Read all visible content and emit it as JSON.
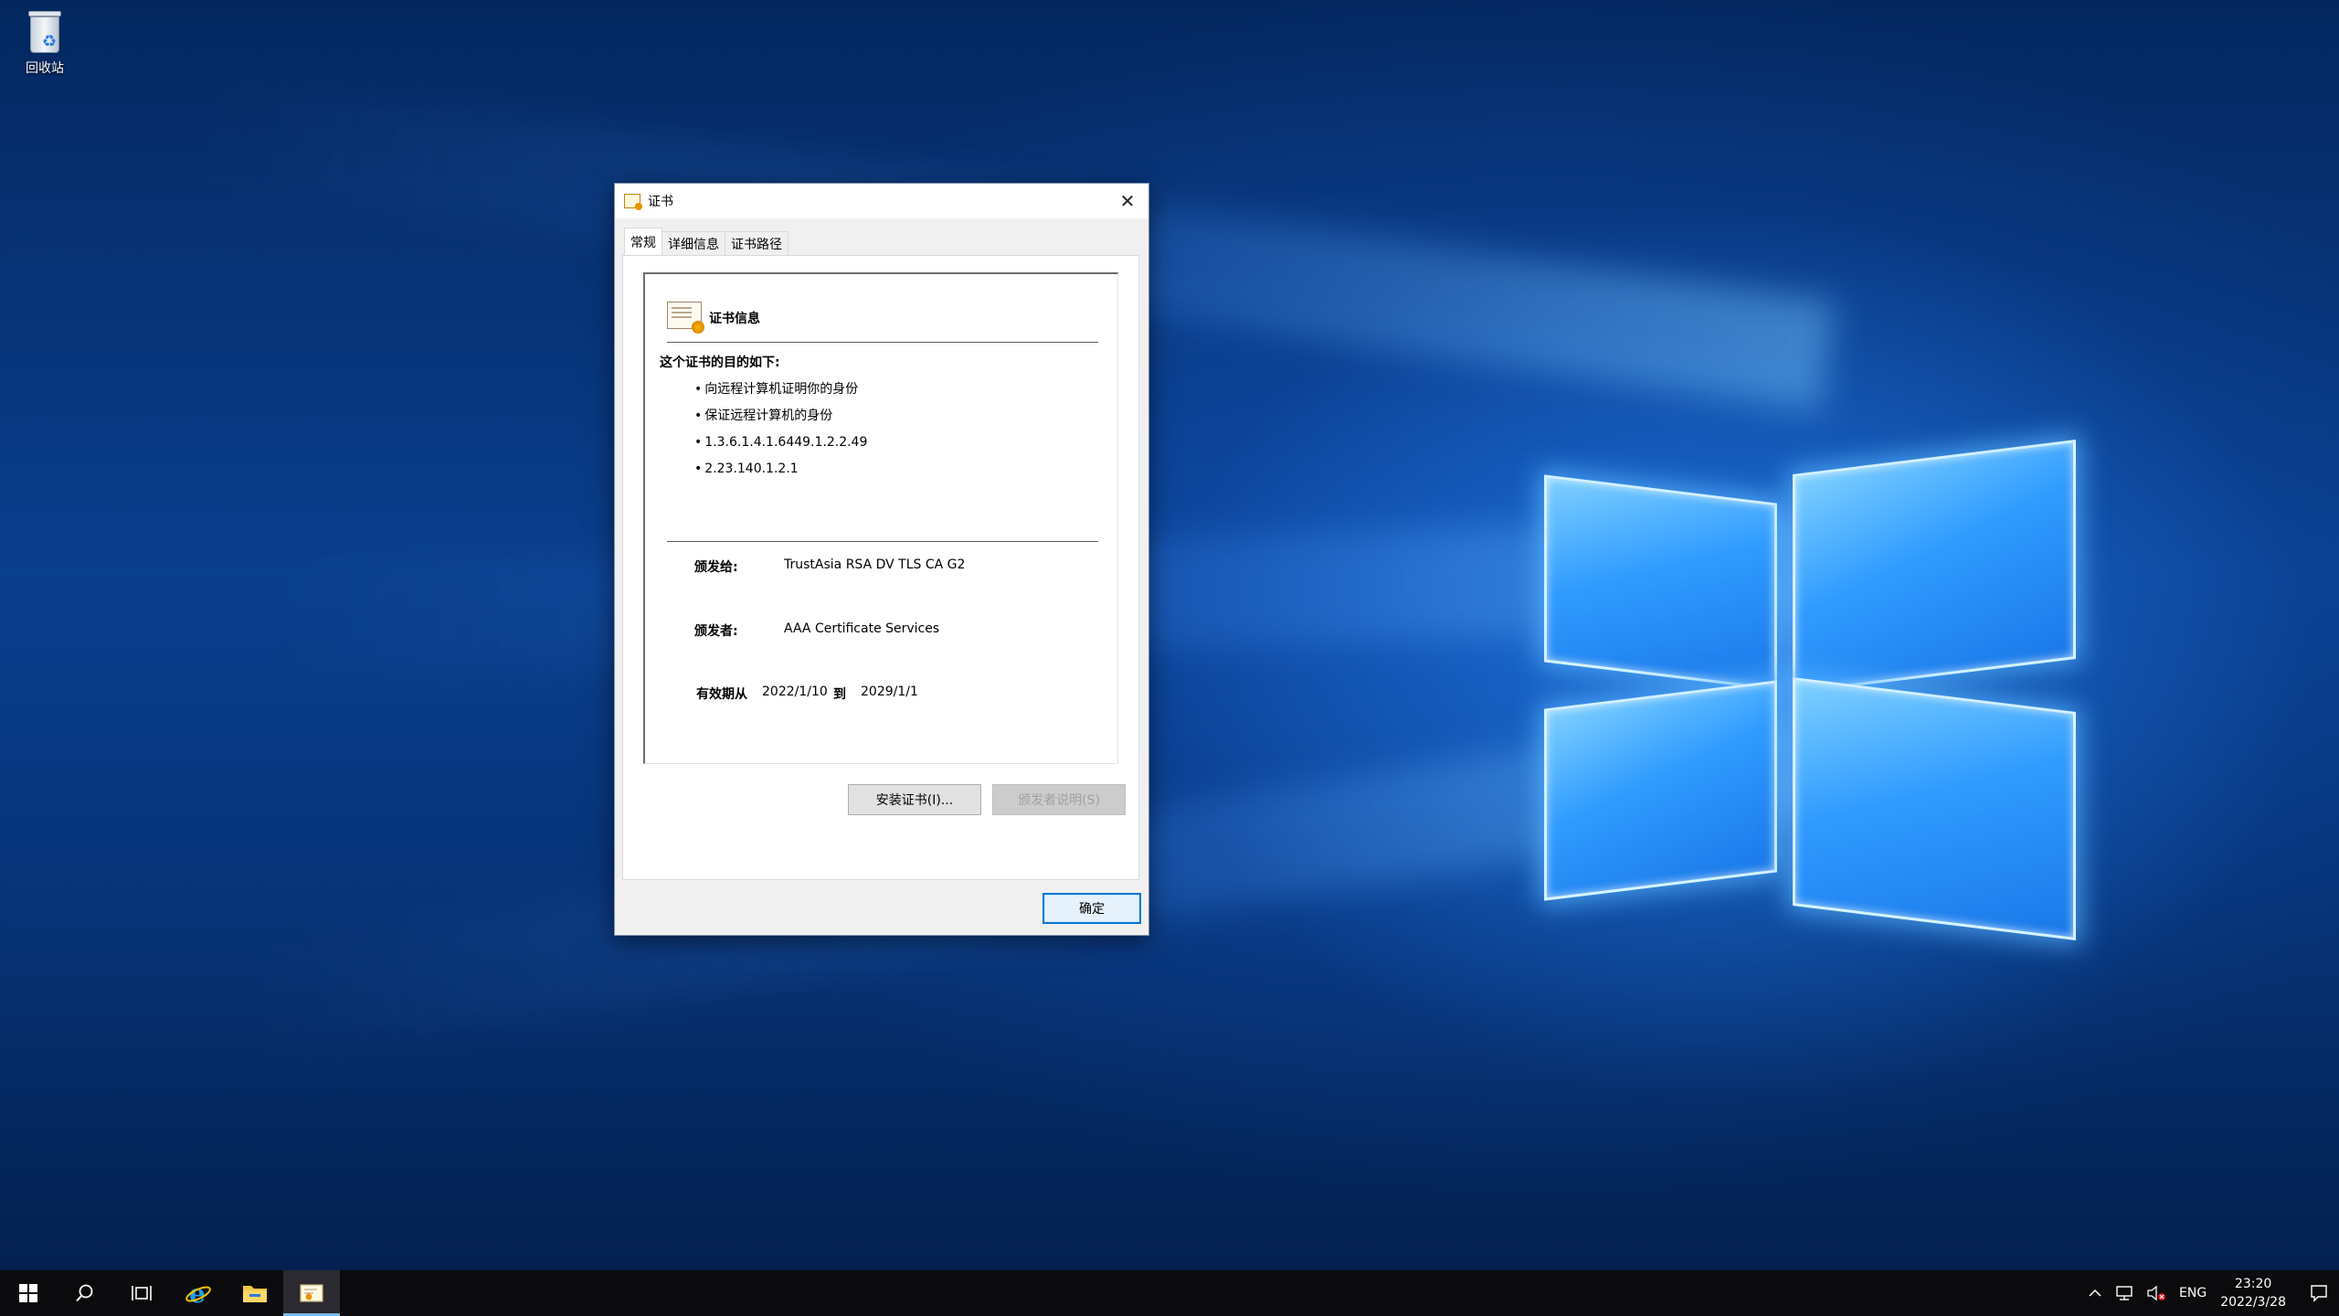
{
  "desktop": {
    "icons": [
      {
        "label": "回收站",
        "icon": "recycle-bin-icon"
      }
    ]
  },
  "dialog": {
    "title": "证书",
    "close_glyph": "✕",
    "tabs": [
      {
        "label": "常规",
        "active": true
      },
      {
        "label": "详细信息",
        "active": false
      },
      {
        "label": "证书路径",
        "active": false
      }
    ],
    "info_header": "证书信息",
    "purpose_title": "这个证书的目的如下:",
    "purposes": [
      "向远程计算机证明你的身份",
      "保证远程计算机的身份",
      "1.3.6.1.4.1.6449.1.2.2.49",
      "2.23.140.1.2.1"
    ],
    "issued_to_label": "颁发给:",
    "issued_to_value": "TrustAsia RSA DV TLS CA G2",
    "issued_by_label": "颁发者:",
    "issued_by_value": "AAA Certificate Services",
    "validity_label": "有效期从",
    "valid_from": "2022/1/10",
    "validity_to_word": "到",
    "valid_to": "2029/1/1",
    "install_button": "安装证书(I)...",
    "issuer_statement_button": "颁发者说明(S)",
    "issuer_statement_enabled": false,
    "ok_button": "确定"
  },
  "taskbar": {
    "items": [
      {
        "name": "start",
        "icon": "windows-logo-icon"
      },
      {
        "name": "search",
        "icon": "search-icon"
      },
      {
        "name": "task-view",
        "icon": "task-view-icon"
      },
      {
        "name": "internet-explorer",
        "icon": "ie-icon"
      },
      {
        "name": "file-explorer",
        "icon": "folder-icon"
      },
      {
        "name": "certificate",
        "icon": "certificate-icon",
        "active": true
      }
    ],
    "tray": {
      "language": "ENG",
      "time": "23:20",
      "date": "2022/3/28"
    }
  },
  "colors": {
    "accent": "#0078d7",
    "taskbar_bg": "#0b0b0e",
    "active_indicator": "#76b9ed"
  }
}
